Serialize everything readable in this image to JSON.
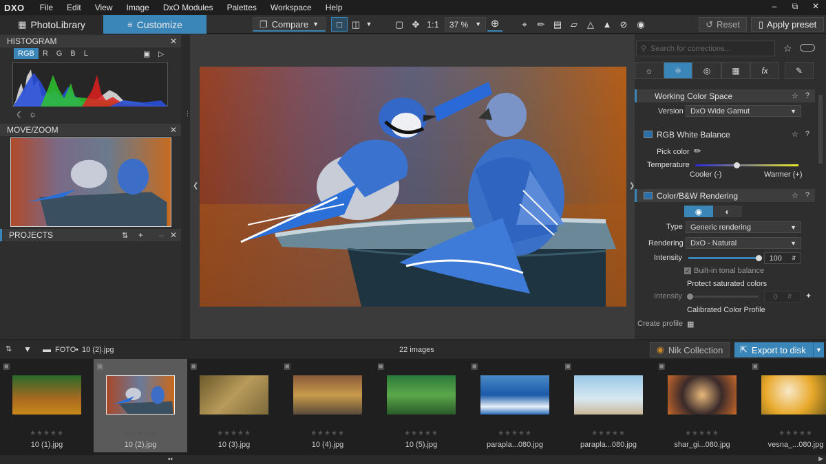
{
  "app": {
    "logo": "DXO"
  },
  "menu": [
    "File",
    "Edit",
    "View",
    "Image",
    "DxO Modules",
    "Palettes",
    "Workspace",
    "Help"
  ],
  "tabs": {
    "library": "PhotoLibrary",
    "customize": "Customize"
  },
  "toolbar": {
    "compare": "Compare",
    "one_to_one": "1:1",
    "zoom": "37 %",
    "reset": "Reset",
    "apply_preset": "Apply preset"
  },
  "left_panel": {
    "histogram_title": "HISTOGRAM",
    "hist_channels": [
      "RGB",
      "R",
      "G",
      "B",
      "L"
    ],
    "movezoom_title": "MOVE/ZOOM",
    "projects_title": "PROJECTS"
  },
  "right_panel": {
    "search_placeholder": "Search for corrections...",
    "working_color_space": {
      "title": "Working Color Space",
      "version_label": "Version",
      "version_value": "DxO Wide Gamut"
    },
    "white_balance": {
      "title": "RGB White Balance",
      "pick_color": "Pick color",
      "temperature": "Temperature",
      "cooler": "Cooler (-)",
      "warmer": "Warmer (+)"
    },
    "rendering": {
      "title": "Color/B&W Rendering",
      "type_label": "Type",
      "type_value": "Generic rendering",
      "rendering_label": "Rendering",
      "rendering_value": "DxO - Natural",
      "intensity_label": "Intensity",
      "intensity_value": "100",
      "builtin_tonal": "Built-in tonal balance",
      "protect_saturated": "Protect saturated colors",
      "intensity2_label": "Intensity",
      "intensity2_value": "0",
      "calibrated": "Calibrated Color Profile",
      "create_profile": "Create profile"
    }
  },
  "filmbar": {
    "folder": "FOTO",
    "current_file": "10 (2).jpg",
    "count": "22 images",
    "nik": "Nik Collection",
    "export": "Export to disk"
  },
  "filmstrip": [
    {
      "name": "10 (1).jpg"
    },
    {
      "name": "10 (2).jpg"
    },
    {
      "name": "10 (3).jpg"
    },
    {
      "name": "10 (4).jpg"
    },
    {
      "name": "10 (5).jpg"
    },
    {
      "name": "parapla...080.jpg"
    },
    {
      "name": "parapla...080.jpg"
    },
    {
      "name": "shar_gi...080.jpg"
    },
    {
      "name": "vesna_...080.jpg"
    }
  ],
  "colors": {
    "accent": "#3b86b8"
  }
}
